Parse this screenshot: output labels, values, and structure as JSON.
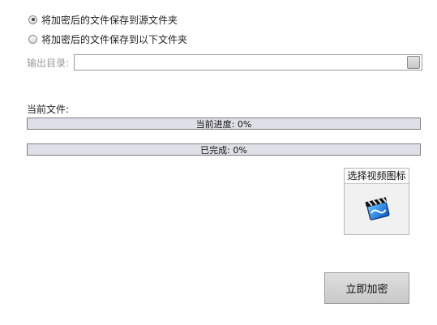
{
  "save_options": [
    {
      "label": "将加密后的文件保存到源文件夹",
      "selected": true
    },
    {
      "label": "将加密后的文件保存到以下文件夹",
      "selected": false
    }
  ],
  "output_dir": {
    "label": "输出目录:",
    "value": ""
  },
  "current_file": {
    "label": "当前文件:",
    "value": ""
  },
  "current_progress": {
    "label": "当前进度:",
    "percent_text": "0%",
    "value": 0
  },
  "completed": {
    "label": "已完成:",
    "percent_text": "0%",
    "value": 0
  },
  "video_icon": {
    "title": "选择视频图标",
    "icon": "clapperboard-icon"
  },
  "encrypt_button": {
    "label": "立即加密"
  }
}
